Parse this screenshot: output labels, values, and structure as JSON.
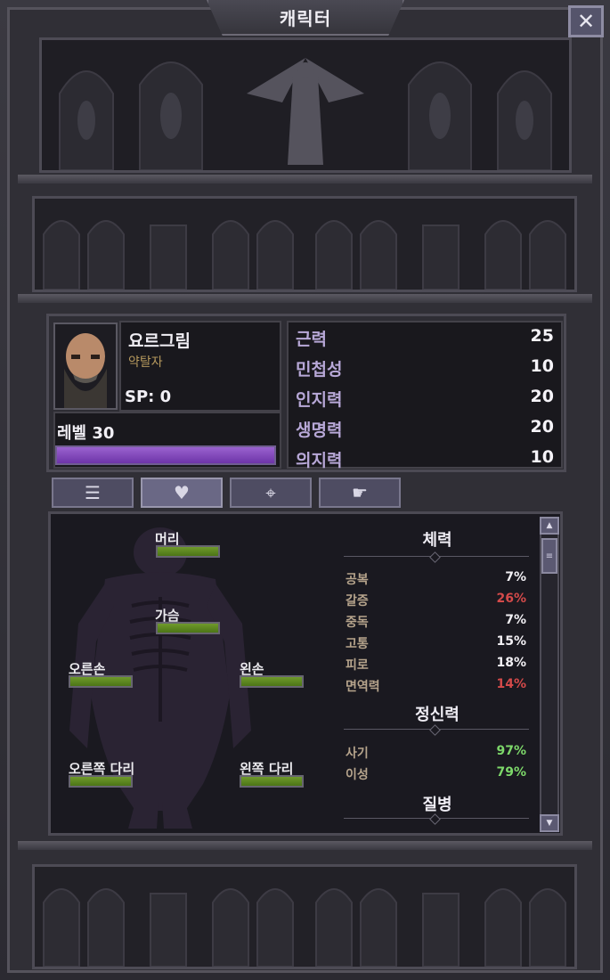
{
  "window": {
    "title": "캐릭터",
    "close_label": "✕"
  },
  "character": {
    "name": "요르그림",
    "class": "약탈자",
    "sp_label": "SP:",
    "sp_value": "0",
    "level_label": "레벨",
    "level_value": "30",
    "xp_fraction": 1.0
  },
  "stats": [
    {
      "label": "근력",
      "value": "25"
    },
    {
      "label": "민첩성",
      "value": "10"
    },
    {
      "label": "인지력",
      "value": "20"
    },
    {
      "label": "생명력",
      "value": "20"
    },
    {
      "label": "의지력",
      "value": "10"
    }
  ],
  "tabs": [
    {
      "icon": "list-icon",
      "glyph": "☰",
      "active": false
    },
    {
      "icon": "heart-icon",
      "glyph": "♥",
      "active": true
    },
    {
      "icon": "crosshair-icon",
      "glyph": "⌖",
      "active": false
    },
    {
      "icon": "hand-icon",
      "glyph": "☛",
      "active": false
    }
  ],
  "body_parts": [
    {
      "label": "머리",
      "health": 1.0
    },
    {
      "label": "가슴",
      "health": 1.0
    },
    {
      "label": "오른손",
      "health": 1.0
    },
    {
      "label": "왼손",
      "health": 1.0
    },
    {
      "label": "오른쪽 다리",
      "health": 1.0
    },
    {
      "label": "왼쪽 다리",
      "health": 1.0
    }
  ],
  "sections": {
    "physical_title": "체력",
    "mental_title": "정신력",
    "disease_title": "질병"
  },
  "physical": [
    {
      "label": "공복",
      "value": "7%",
      "color": "#f2f0f4"
    },
    {
      "label": "갈증",
      "value": "26%",
      "color": "#d44a4a"
    },
    {
      "label": "중독",
      "value": "7%",
      "color": "#f2f0f4"
    },
    {
      "label": "고통",
      "value": "15%",
      "color": "#f2f0f4"
    },
    {
      "label": "피로",
      "value": "18%",
      "color": "#f2f0f4"
    },
    {
      "label": "면역력",
      "value": "14%",
      "color": "#d44a4a"
    }
  ],
  "mental": [
    {
      "label": "사기",
      "value": "97%",
      "color": "#7dd86a"
    },
    {
      "label": "이성",
      "value": "79%",
      "color": "#7dd86a"
    }
  ],
  "scroll": {
    "up_glyph": "▲",
    "down_glyph": "▼",
    "thumb_glyph": "≡"
  },
  "colors": {
    "xp_bar": "#8a52c4",
    "health_bar": "#5f8a22",
    "accent": "#b8a8d8"
  }
}
